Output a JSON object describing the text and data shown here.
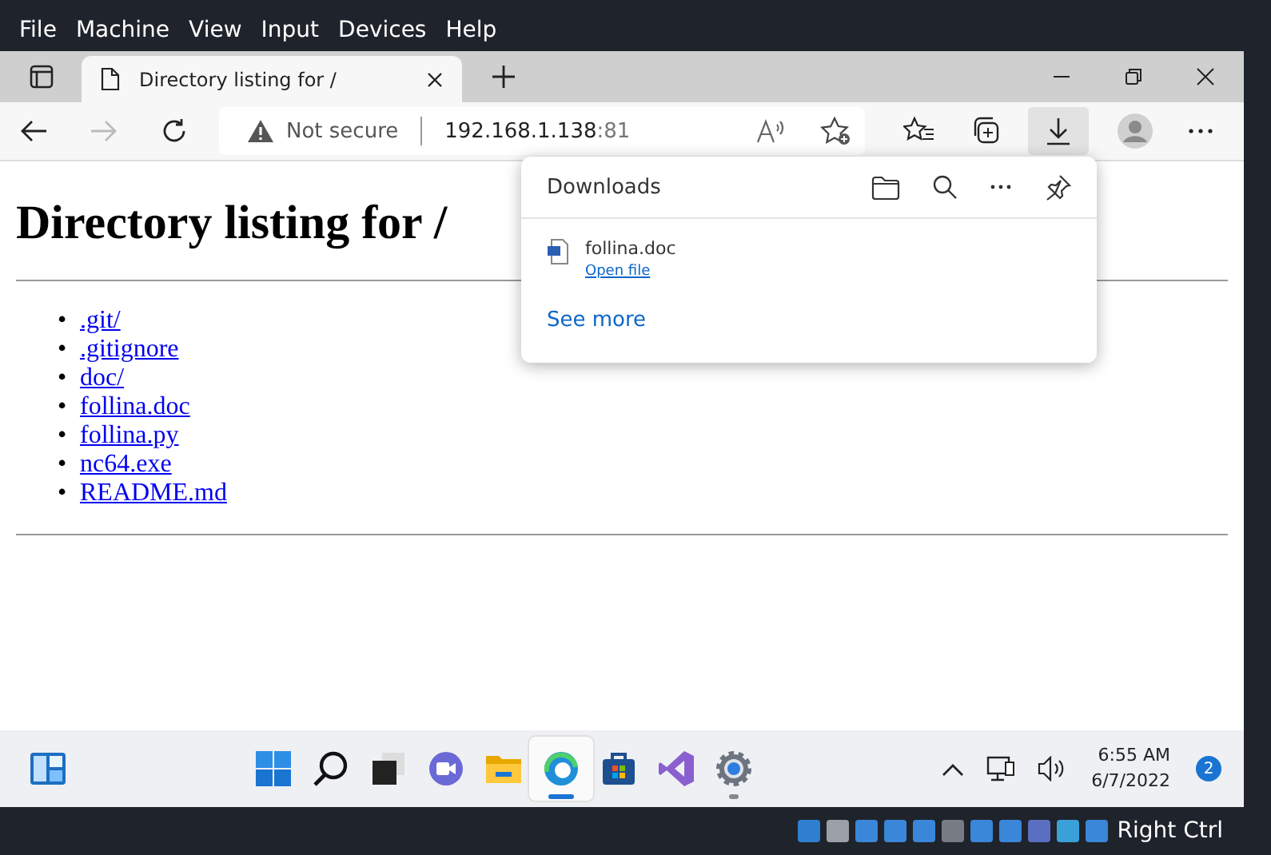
{
  "menu": [
    "File",
    "Machine",
    "View",
    "Input",
    "Devices",
    "Help"
  ],
  "tabs": [
    {
      "title": "Directory listing for /",
      "selected": true
    }
  ],
  "address": {
    "security": "Not secure",
    "host": "192.168.1.138",
    "port": ":81"
  },
  "downloads_button": {
    "selected": true
  },
  "page": {
    "heading": "Directory listing for /",
    "links": [
      {
        "bullet": "•",
        "name": ".git/"
      },
      {
        "bullet": "•",
        "name": ".gitignore"
      },
      {
        "bullet": "•",
        "name": "doc/"
      },
      {
        "bullet": "•",
        "name": "follina.doc"
      },
      {
        "bullet": "•",
        "name": "follina.py"
      },
      {
        "bullet": "•",
        "name": "nc64.exe"
      },
      {
        "bullet": "•",
        "name": "README.md"
      }
    ]
  },
  "downloads": {
    "title": "Downloads",
    "items": [
      {
        "name": "follina.doc",
        "action": "Open file"
      }
    ],
    "see_more": "See more"
  },
  "taskbar": {
    "apps": [
      {
        "kind": "start",
        "selected": false,
        "running": false
      },
      {
        "kind": "search",
        "selected": false,
        "running": false
      },
      {
        "kind": "taskview",
        "selected": false,
        "running": false
      },
      {
        "kind": "chat",
        "selected": false,
        "running": false
      },
      {
        "kind": "explorer",
        "selected": false,
        "running": false
      },
      {
        "kind": "edge",
        "selected": true,
        "running": true
      },
      {
        "kind": "store",
        "selected": false,
        "running": false
      },
      {
        "kind": "vstudio",
        "selected": false,
        "running": false
      },
      {
        "kind": "settings",
        "selected": false,
        "running": true
      }
    ],
    "time": "6:55 AM",
    "date": "6/7/2022",
    "notifications": "2"
  },
  "vm_status": {
    "host_key": "Right Ctrl"
  }
}
